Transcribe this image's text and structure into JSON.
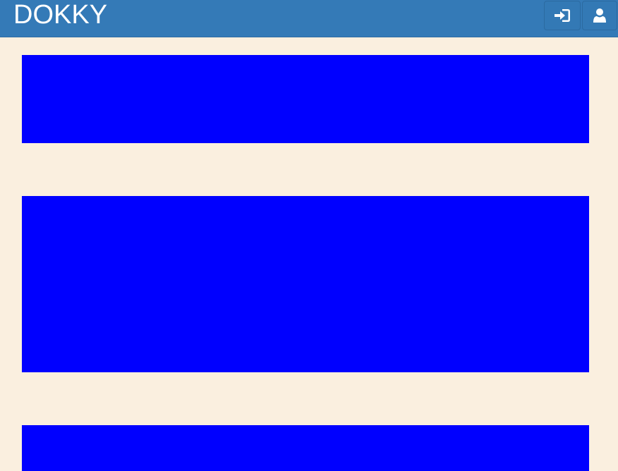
{
  "header": {
    "brand": "DOKKY",
    "background_color": "#347ab7",
    "buttons": [
      {
        "name": "login",
        "icon": "sign-in-icon"
      },
      {
        "name": "user",
        "icon": "user-icon"
      }
    ]
  },
  "page": {
    "background_color": "#faefdf",
    "blocks": [
      {
        "color": "#0000ff"
      },
      {
        "color": "#0000ff"
      },
      {
        "color": "#0000ff"
      }
    ]
  }
}
